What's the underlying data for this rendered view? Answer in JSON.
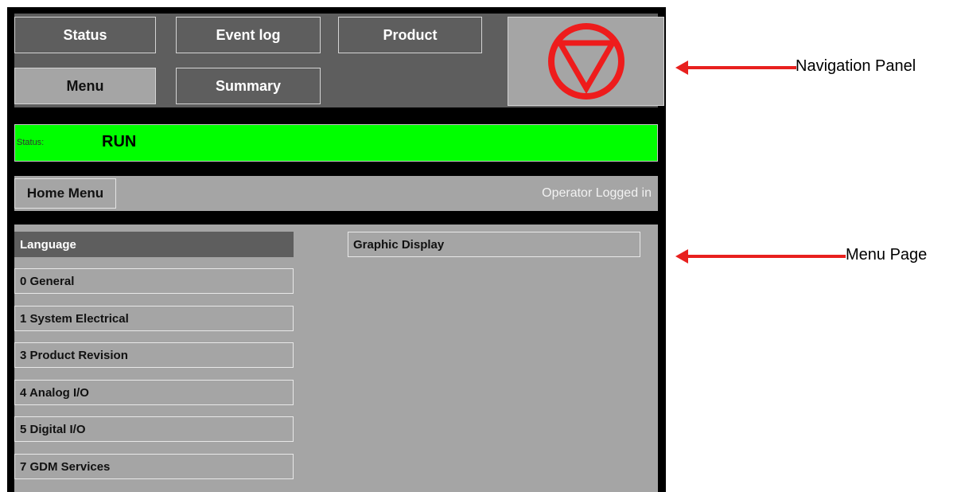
{
  "nav": {
    "status": "Status",
    "event_log": "Event log",
    "product": "Product",
    "menu": "Menu",
    "summary": "Summary",
    "stop_icon": "stop-triangle-icon"
  },
  "status_bar": {
    "label": "Status:",
    "value": "RUN",
    "color": "#00ff00"
  },
  "menu_header": {
    "home_menu": "Home Menu",
    "login_status": "Operator Logged in"
  },
  "menu_items_left": [
    {
      "label": "Language"
    },
    {
      "label": "0 General"
    },
    {
      "label": "1 System Electrical"
    },
    {
      "label": "3 Product Revision"
    },
    {
      "label": "4 Analog I/O"
    },
    {
      "label": "5 Digital I/O"
    },
    {
      "label": "7 GDM Services"
    }
  ],
  "menu_items_right": [
    {
      "label": "Graphic Display"
    }
  ],
  "annotations": {
    "navigation_panel": "Navigation Panel",
    "menu_page": "Menu Page",
    "arrow_color": "#e8201e"
  }
}
